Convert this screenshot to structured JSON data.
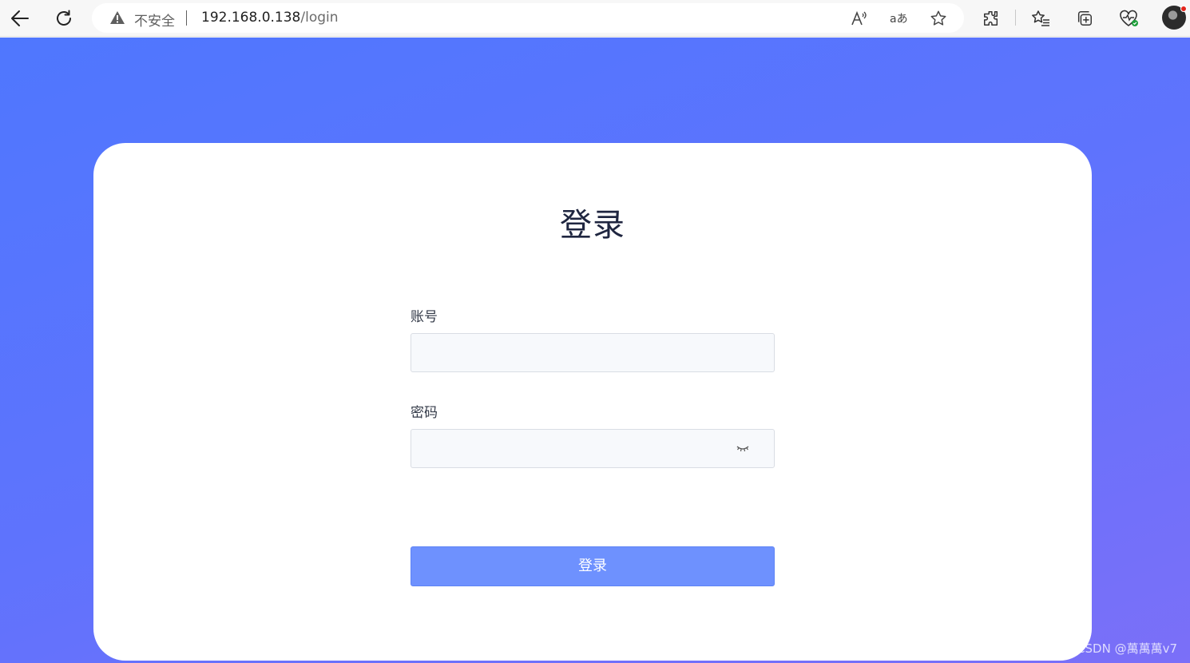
{
  "browser": {
    "security_label": "不安全",
    "url_host": "192.168.0.138",
    "url_path": "/login"
  },
  "login": {
    "title": "登录",
    "account_label": "账号",
    "account_value": "",
    "password_label": "密码",
    "password_value": "",
    "submit_label": "登录"
  },
  "watermark": "CSDN @萬萬萬v7",
  "colors": {
    "gradient_start": "#4f77fe",
    "gradient_end": "#7b6ff8",
    "button": "#6e91fe",
    "field_bg": "#f7f9fc"
  }
}
